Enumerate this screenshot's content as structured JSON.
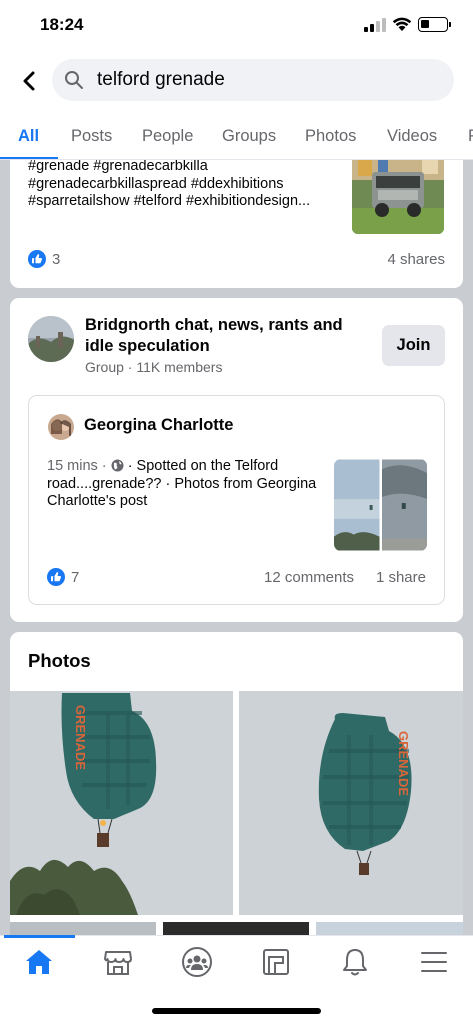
{
  "status_bar": {
    "time": "18:24",
    "battery_level": 0.35
  },
  "search": {
    "query": "telford grenade",
    "placeholder": "Search"
  },
  "tabs": [
    {
      "label": "All",
      "active": true
    },
    {
      "label": "Posts"
    },
    {
      "label": "People"
    },
    {
      "label": "Groups"
    },
    {
      "label": "Photos"
    },
    {
      "label": "Videos"
    },
    {
      "label": "P"
    }
  ],
  "post1": {
    "hashtags": "#grenade #grenadecarbkilla #grenadecarbkillaspread #ddexhibitions #sparretailshow #telford #exhibitiondesign...",
    "likes": "3",
    "shares": "4 shares"
  },
  "group": {
    "name": "Bridgnorth chat, news, rants and idle speculation",
    "meta": "Group · 11K members",
    "join_label": "Join",
    "post": {
      "author": "Georgina Charlotte",
      "time": "15 mins ·",
      "text": "· Spotted on the Telford road....grenade?? · Photos from Georgina Charlotte's post",
      "likes": "7",
      "comments": "12 comments",
      "shares": "1 share"
    }
  },
  "photos": {
    "title": "Photos",
    "balloon_text": "GRENADE"
  },
  "colors": {
    "accent": "#1877f2",
    "secondary_text": "#65676b",
    "feed_bg": "#c9ccd1",
    "balloon": "#2f6a66"
  },
  "bottom_nav": [
    {
      "icon": "home-icon",
      "active": true
    },
    {
      "icon": "marketplace-icon"
    },
    {
      "icon": "groups-icon"
    },
    {
      "icon": "feeds-icon"
    },
    {
      "icon": "bell-icon"
    },
    {
      "icon": "menu-icon"
    }
  ]
}
